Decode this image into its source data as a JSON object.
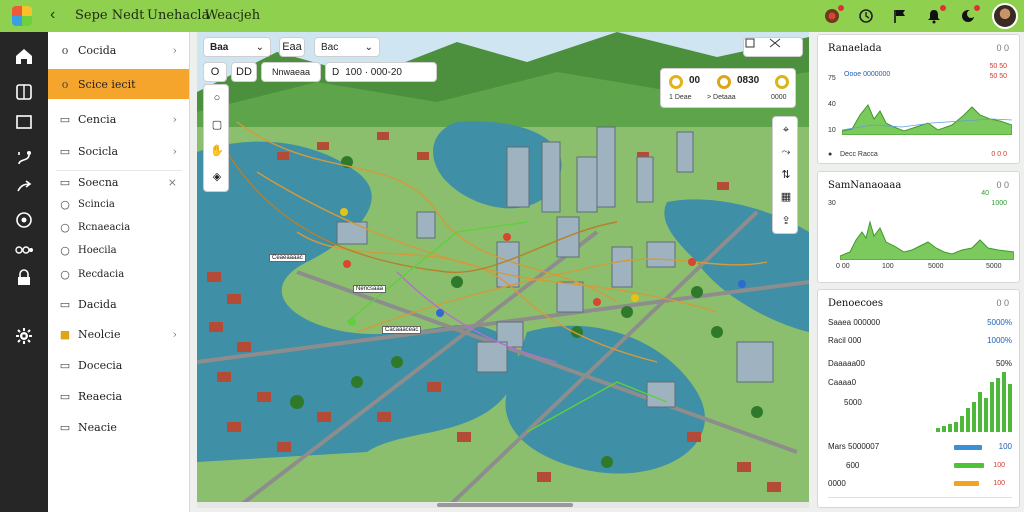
{
  "colors": {
    "topbar": "#8fd14f",
    "rail": "#262626",
    "active_nav": "#f5a52b",
    "chart_green": "#5ebb46",
    "bar_blue": "#3a8fd6",
    "bar_green": "#4fc23a",
    "bar_orange": "#f2a41f"
  },
  "header": {
    "back_icon": "chevron-left-icon",
    "crumbs": [
      "Sepe Nedt",
      "Unehacla",
      "Weacjeh"
    ]
  },
  "top_icons": [
    "record-icon",
    "clock-icon",
    "flag-icon",
    "bell-icon",
    "dark-mode-icon"
  ],
  "rail_icons": [
    "home-icon",
    "layers-icon",
    "frame-icon",
    "route-icon",
    "share-icon",
    "target-icon",
    "settings-grid-icon",
    "lock-icon",
    "gear-icon"
  ],
  "nav": {
    "items": [
      {
        "label": "Cocida",
        "icon": "o",
        "chevron": "›"
      },
      {
        "label": "Scice iecit",
        "icon": "o",
        "chevron": ""
      },
      {
        "label": "Cencia",
        "icon": "▭",
        "chevron": "›"
      },
      {
        "label": "Socicla",
        "icon": "▭",
        "chevron": "›"
      },
      {
        "label": "Soecna",
        "icon": "▭",
        "chevron": "×"
      },
      {
        "label": "Scincia",
        "icon": "○",
        "chevron": ""
      },
      {
        "label": "Rcnaeacia",
        "icon": "○",
        "chevron": ""
      },
      {
        "label": "Hoecila",
        "icon": "○",
        "chevron": ""
      },
      {
        "label": "Recdacia",
        "icon": "○",
        "chevron": ""
      },
      {
        "label": "Dacida",
        "icon": "▭",
        "chevron": ""
      },
      {
        "label": "Neolcie",
        "icon": "■",
        "chevron": "›"
      },
      {
        "label": "Docecia",
        "icon": "▭",
        "chevron": ""
      },
      {
        "label": "Reaecia",
        "icon": "▭",
        "chevron": ""
      },
      {
        "label": "Neacie",
        "icon": "▭",
        "chevron": ""
      }
    ]
  },
  "map": {
    "search": {
      "label": "Baa",
      "value": "Bac",
      "chevron": "⌄"
    },
    "filter_label": "Eaa",
    "time_label": "D",
    "time_value": "100 · 000-20",
    "row2_tabs": [
      "O",
      "DD",
      "Nnwaeaa"
    ],
    "legend": [
      {
        "value": "00",
        "sub": "1 Deae"
      },
      {
        "value": "0830",
        "sub": "> Detaaa"
      },
      {
        "value": "",
        "sub": "0000"
      }
    ],
    "labels": [
      "Ceaeaaaac",
      "Nencsaaa",
      "Cacaaaceac"
    ]
  },
  "panel1": {
    "title": "Ranaelada",
    "action": "0 0",
    "legend_main": "Oooe 0000000",
    "legend_red": "50 50",
    "y_ticks": [
      "75",
      "40",
      "10",
      "0"
    ],
    "footer_left": "Decc Racca",
    "footer_right": "0 0 0"
  },
  "panel2": {
    "title": "SamNanaoaaa",
    "action": "0 0",
    "value_a": "40",
    "value_b": "1000",
    "y_ticks": [
      "30",
      "0"
    ],
    "x_ticks": [
      "0 00",
      "100",
      "5000",
      "5000"
    ]
  },
  "panel3": {
    "title": "Denoecoes",
    "action": "0 0",
    "rows": [
      {
        "label": "Saaea 000000",
        "value": "5000%",
        "color": "blue"
      },
      {
        "label": "Racil 000",
        "value": "1000%",
        "color": "blue"
      },
      {
        "label": "Daaaaa00",
        "value": "50%",
        "color": ""
      },
      {
        "label": "Caaaa0",
        "value": "",
        "color": ""
      },
      {
        "label": "5000",
        "value": "",
        "color": ""
      }
    ],
    "bars": [
      {
        "label": "Mars 5000007",
        "value": "100",
        "color_key": "blue",
        "fill": 0.7
      },
      {
        "label": "600",
        "value": "100",
        "color_key": "green",
        "fill": 0.74
      },
      {
        "label": "0000",
        "value": "100",
        "color_key": "orange",
        "fill": 0.62
      }
    ]
  }
}
